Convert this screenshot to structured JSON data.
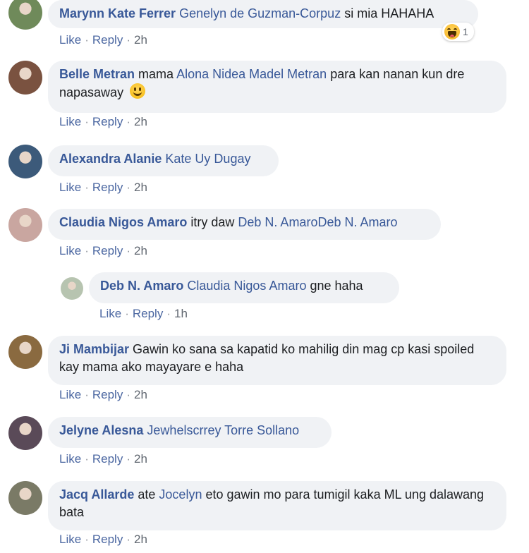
{
  "actions": {
    "like": "Like",
    "reply": "Reply",
    "dot": "·"
  },
  "comments": [
    {
      "author": "Marynn Kate Ferrer",
      "segments": [
        {
          "type": "mention",
          "text": "Genelyn de Guzman-Corpuz"
        },
        {
          "type": "text",
          "text": " si mia HAHAHA"
        }
      ],
      "time": "2h",
      "reaction": {
        "icon": "haha-reaction-icon",
        "count": "1"
      },
      "avatar_color": "#6f8a5a"
    },
    {
      "author": "Belle Metran",
      "segments": [
        {
          "type": "text",
          "text": " mama "
        },
        {
          "type": "mention",
          "text": "Alona Nidea Madel Metran"
        },
        {
          "type": "text",
          "text": " para kan nanan kun dre napasaway"
        }
      ],
      "emoji": "smiling-face-emoji",
      "time": "2h",
      "avatar_color": "#7a5240"
    },
    {
      "author": "Alexandra Alanie",
      "segments": [
        {
          "type": "text",
          "text": " "
        },
        {
          "type": "mention",
          "text": "Kate Uy Dugay"
        }
      ],
      "time": "2h",
      "avatar_color": "#3c5a7a"
    },
    {
      "author": "Claudia Nigos Amaro",
      "segments": [
        {
          "type": "text",
          "text": " itry daw "
        },
        {
          "type": "mention",
          "text": "Deb N. AmaroDeb N. Amaro"
        }
      ],
      "time": "2h",
      "avatar_color": "#c9a6a0"
    },
    {
      "author": "Deb N. Amaro",
      "segments": [
        {
          "type": "text",
          "text": " "
        },
        {
          "type": "mention",
          "text": "Claudia Nigos Amaro"
        },
        {
          "type": "text",
          "text": " gne haha"
        }
      ],
      "time": "1h",
      "reply": true,
      "avatar_color": "#b7c4b0"
    },
    {
      "author": "Ji Mambijar",
      "segments": [
        {
          "type": "text",
          "text": " Gawin ko sana sa kapatid ko mahilig din mag cp kasi spoiled kay mama ako mayayare e haha"
        }
      ],
      "time": "2h",
      "avatar_color": "#8a6a40"
    },
    {
      "author": "Jelyne Alesna",
      "segments": [
        {
          "type": "text",
          "text": " "
        },
        {
          "type": "mention",
          "text": "Jewhelscrrey Torre Sollano"
        }
      ],
      "time": "2h",
      "avatar_color": "#5a4a58"
    },
    {
      "author": "Jacq Allarde",
      "segments": [
        {
          "type": "text",
          "text": " ate "
        },
        {
          "type": "mention",
          "text": "Jocelyn"
        },
        {
          "type": "text",
          "text": " eto gawin mo para tumigil kaka ML ung dalawang bata"
        }
      ],
      "time": "2h",
      "avatar_color": "#7a7a66"
    }
  ]
}
